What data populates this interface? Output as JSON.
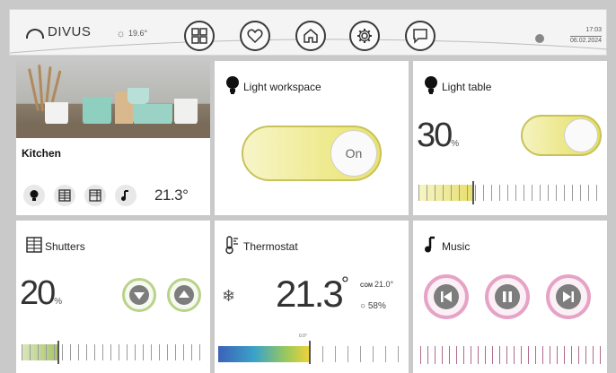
{
  "header": {
    "brand": "DIVUS",
    "weather_temp": "19.6°",
    "time": "17:03",
    "date": "06.02.2024",
    "nav_icons": [
      "grid-icon",
      "heart-icon",
      "home-icon",
      "gear-icon",
      "chat-icon"
    ]
  },
  "kitchen": {
    "name": "Kitchen",
    "temperature": "21.3°",
    "icons": [
      "bulb-icon",
      "shutter-icon",
      "blind-icon",
      "music-note-icon"
    ]
  },
  "light_workspace": {
    "title": "Light workspace",
    "state_label": "On"
  },
  "light_table": {
    "title": "Light table",
    "value": "30",
    "unit": "%",
    "level_percent": 30
  },
  "shutters": {
    "title": "Shutters",
    "value": "20",
    "unit": "%",
    "level_percent": 20
  },
  "thermostat": {
    "title": "Thermostat",
    "value": "21.3",
    "degree": "°",
    "comfort_label": "COM",
    "comfort_value": "21.0°",
    "humidity": "58%",
    "scale_mark": "0.0°",
    "mode_icon": "snowflake-icon"
  },
  "music": {
    "title": "Music",
    "controls": [
      "previous-icon",
      "pause-icon",
      "next-icon"
    ]
  },
  "colors": {
    "accent_yellow": "#e9e36a",
    "accent_green": "#a8c36a",
    "accent_pink": "#d86aa6",
    "background": "#c9c9c9"
  }
}
